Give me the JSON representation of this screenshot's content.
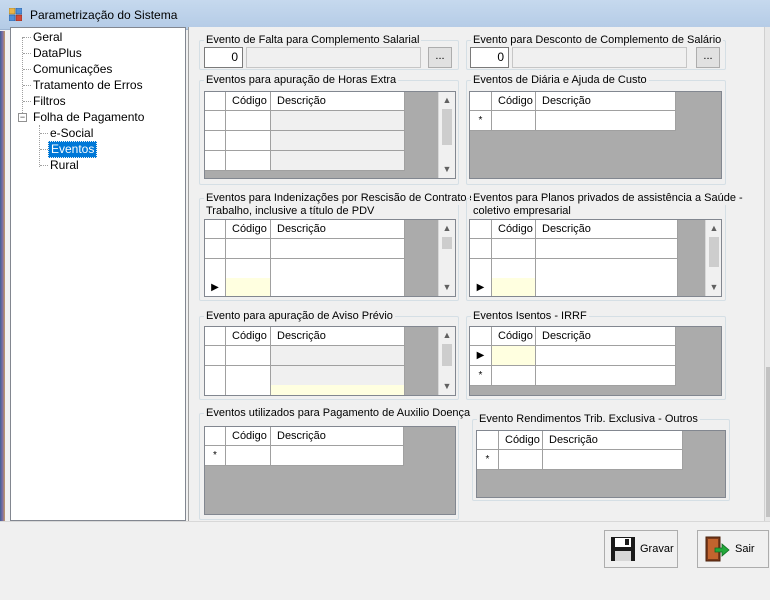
{
  "window": {
    "title": "Parametrização do Sistema"
  },
  "tree": {
    "items": [
      {
        "label": "Geral"
      },
      {
        "label": "DataPlus"
      },
      {
        "label": "Comunicações"
      },
      {
        "label": "Tratamento de Erros"
      },
      {
        "label": "Filtros"
      },
      {
        "label": "Folha de Pagamento",
        "expander": "−"
      },
      {
        "label": "e-Social"
      },
      {
        "label": "Eventos",
        "selected": true
      },
      {
        "label": "Rural"
      }
    ]
  },
  "columns": {
    "codigo": "Código",
    "descricao": "Descrição"
  },
  "markers": {
    "new_row": "*",
    "current_row": "▶",
    "ellipsis": "..."
  },
  "sections": {
    "falta": {
      "label": "Evento de Falta para Complemento Salarial",
      "value": "0"
    },
    "desconto": {
      "label": "Evento para Desconto de Complemento de Salário",
      "value": "0"
    },
    "horas_extra": {
      "label": "Eventos para apuração de Horas Extra"
    },
    "diaria": {
      "label": "Eventos de Diária e Ajuda de Custo"
    },
    "indenizacoes": {
      "label_line1": "Eventos para Indenizações por Rescisão de Contrato de",
      "label_line2": "Trabalho, inclusive a título de PDV"
    },
    "planos_saude": {
      "label_line1": "Eventos para Planos privados de assistência a Saúde -",
      "label_line2": "coletivo empresarial"
    },
    "aviso_previo": {
      "label": "Evento para apuração de Aviso Prévio"
    },
    "isentos_irrf": {
      "label": "Eventos Isentos - IRRF"
    },
    "auxilio_doenca": {
      "label": "Eventos utilizados para Pagamento de Auxilio Doença"
    },
    "rendimentos": {
      "label": "Evento Rendimentos Trib. Exclusiva - Outros"
    }
  },
  "buttons": {
    "gravar": "Gravar",
    "sair": "Sair"
  },
  "colors": {
    "selection": "#0078d7",
    "grid_background": "#ababab",
    "new_row_cell": "#ffffe0"
  }
}
